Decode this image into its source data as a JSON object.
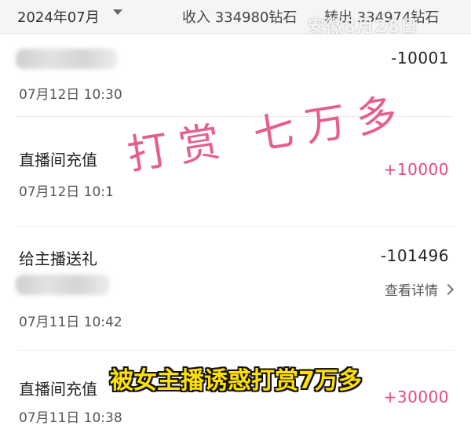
{
  "header": {
    "month": "2024年07月",
    "income": "收入 334980钻石",
    "outgo": "转出 334974钻石",
    "watermark": "安徽8月28日"
  },
  "records": [
    {
      "title": "",
      "amount": "-10001",
      "time": "07月12日 10:30"
    },
    {
      "title": "直播间充值",
      "amount": "+10000",
      "time": "07月12日 10:1"
    },
    {
      "title": "给主播送礼",
      "amount": "-101496",
      "details": "查看详情",
      "time": "07月11日 10:42"
    },
    {
      "title": "直播间充值",
      "amount": "+30000",
      "time": "07月11日 10:38"
    }
  ],
  "overlay": {
    "handwriting": "打赏 七万多",
    "caption": "被女主播诱惑打赏7万多"
  },
  "colors": {
    "positive": "#e64a7a",
    "caption": "#ffe100",
    "handwriting": "#e3477f"
  }
}
